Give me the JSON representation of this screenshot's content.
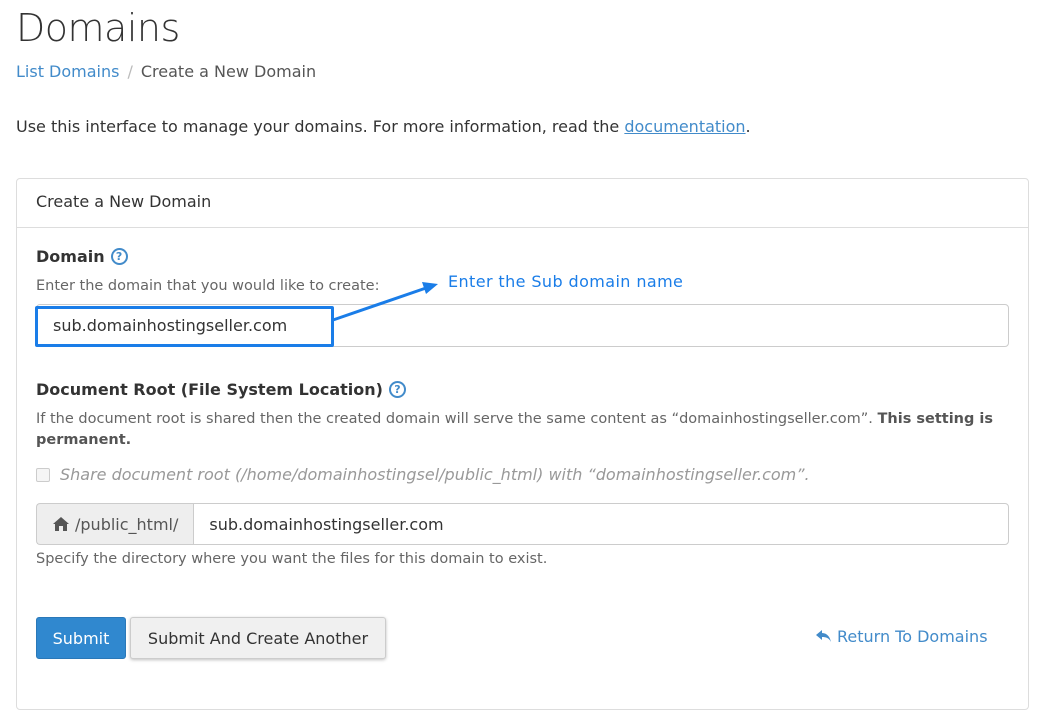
{
  "page": {
    "title": "Domains"
  },
  "breadcrumb": {
    "parent": "List Domains",
    "separator": "/",
    "current": "Create a New Domain"
  },
  "intro": {
    "text": "Use this interface to manage your domains. For more information, read the ",
    "link": "documentation",
    "suffix": "."
  },
  "panel": {
    "heading": "Create a New Domain"
  },
  "domain_field": {
    "label": "Domain",
    "help_icon": "question-circle-icon",
    "help": "Enter the domain that you would like to create:",
    "value": "sub.domainhostingseller.com"
  },
  "annotation": {
    "text": "Enter the Sub domain name",
    "color": "#1a7de8"
  },
  "docroot_field": {
    "label": "Document Root (File System Location)",
    "help_icon": "question-circle-icon",
    "help_prefix": "If the document root is shared then the created domain will serve the same content as “domainhostingseller.com”. ",
    "help_bold": "This setting is permanent.",
    "share_label": "Share document root (/home/domainhostingsel/public_html) with “domainhostingseller.com”.",
    "share_checked": false,
    "addon_icon": "home-icon",
    "addon_label": "/public_html/",
    "value": "sub.domainhostingseller.com",
    "footnote": "Specify the directory where you want the files for this domain to exist."
  },
  "actions": {
    "submit": "Submit",
    "submit_another": "Submit And Create Another",
    "return_icon": "reply-arrow-icon",
    "return": "Return To Domains"
  },
  "colors": {
    "primary": "#3088cf",
    "link": "#428bca",
    "annotation": "#1a7de8"
  }
}
